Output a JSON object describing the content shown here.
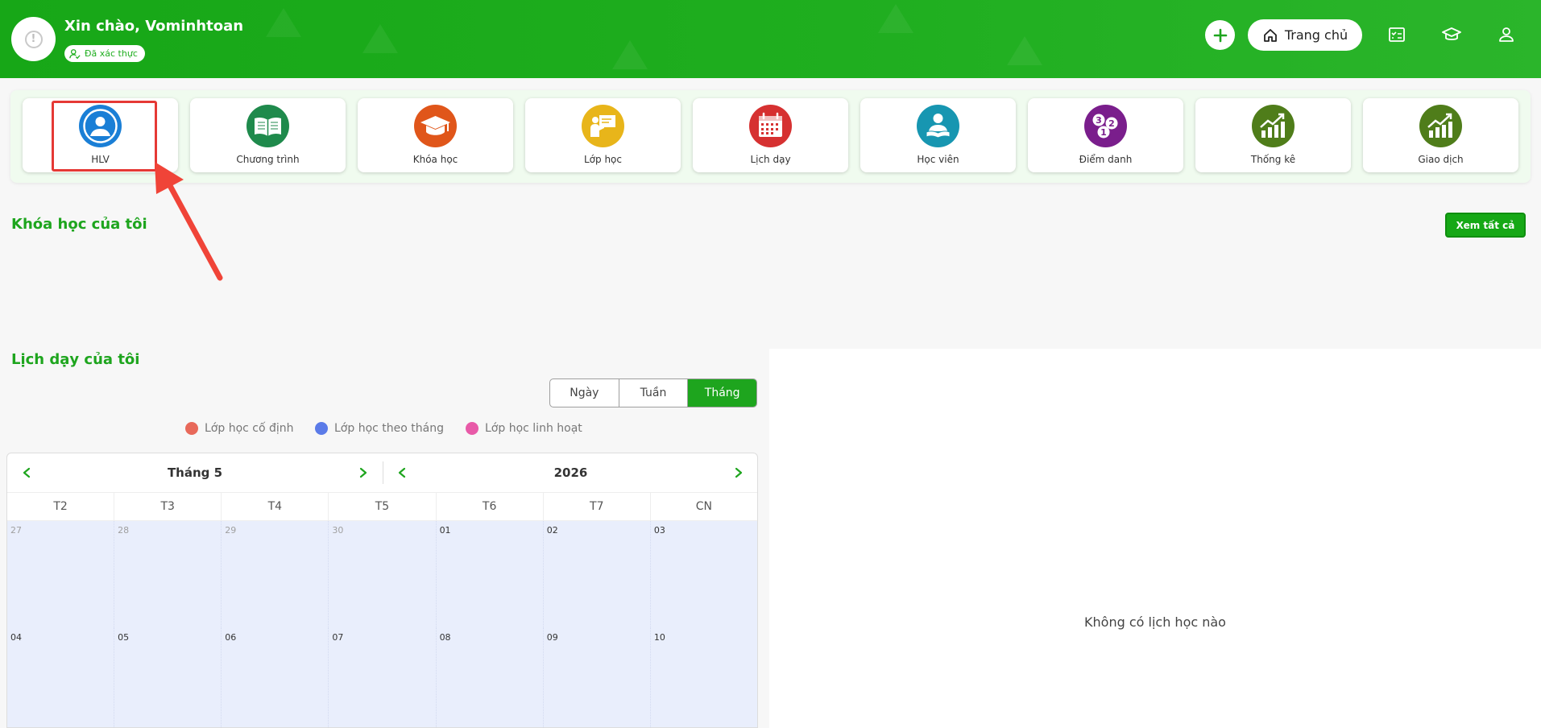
{
  "header": {
    "greeting": "Xin chào, Vominhtoan",
    "verified_label": "Đã xác thực",
    "home_label": "Trang chủ"
  },
  "menu": {
    "items": [
      {
        "label": "HLV",
        "color": "#1a7fd6",
        "icon": "coach-user-icon"
      },
      {
        "label": "Chương trình",
        "color": "#1f8a4c",
        "icon": "book-icon"
      },
      {
        "label": "Khóa học",
        "color": "#e0561a",
        "icon": "graduation-cap-icon"
      },
      {
        "label": "Lớp học",
        "color": "#e8b51a",
        "icon": "teacher-board-icon"
      },
      {
        "label": "Lịch dạy",
        "color": "#d63131",
        "icon": "calendar-icon"
      },
      {
        "label": "Học viên",
        "color": "#1796b1",
        "icon": "student-reading-icon"
      },
      {
        "label": "Điểm danh",
        "color": "#7a1e8c",
        "icon": "attendance-numbers-icon"
      },
      {
        "label": "Thống kê",
        "color": "#4f7d1a",
        "icon": "growth-chart-icon"
      },
      {
        "label": "Giao dịch",
        "color": "#4f7d1a",
        "icon": "transaction-chart-icon"
      }
    ]
  },
  "my_courses": {
    "title": "Khóa học của tôi",
    "see_all": "Xem tất cả"
  },
  "schedule": {
    "title": "Lịch dạy của tôi",
    "views": [
      "Ngày",
      "Tuần",
      "Tháng"
    ],
    "active_view": "Tháng",
    "legend": [
      {
        "label": "Lớp học cố định",
        "color": "#e8695a"
      },
      {
        "label": "Lớp học theo tháng",
        "color": "#5b7be8"
      },
      {
        "label": "Lớp học linh hoạt",
        "color": "#e85aa8"
      }
    ],
    "month_label": "Tháng 5",
    "year_label": "2026",
    "weekdays": [
      "T2",
      "T3",
      "T4",
      "T5",
      "T6",
      "T7",
      "CN"
    ],
    "weeks": [
      [
        {
          "d": "27",
          "muted": true
        },
        {
          "d": "28",
          "muted": true
        },
        {
          "d": "29",
          "muted": true
        },
        {
          "d": "30",
          "muted": true
        },
        {
          "d": "01",
          "muted": false
        },
        {
          "d": "02",
          "muted": false
        },
        {
          "d": "03",
          "muted": false
        }
      ],
      [
        {
          "d": "04",
          "muted": false
        },
        {
          "d": "05",
          "muted": false
        },
        {
          "d": "06",
          "muted": false
        },
        {
          "d": "07",
          "muted": false
        },
        {
          "d": "08",
          "muted": false
        },
        {
          "d": "09",
          "muted": false
        },
        {
          "d": "10",
          "muted": false
        }
      ]
    ],
    "empty_message": "Không có lịch học nào"
  },
  "colors": {
    "brand_green": "#1ea51e",
    "highlight_red": "#e53935"
  }
}
